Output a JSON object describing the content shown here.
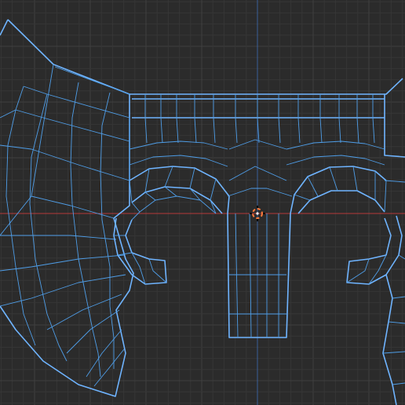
{
  "viewport": {
    "mode": "uv-editor-2d-view",
    "colors": {
      "background": "#2b2b2b",
      "grid_minor": "#363636",
      "grid_major": "#3f3f3f",
      "axis_x": "#b53a3a",
      "axis_y": "#3a5f99",
      "wire": "#4f9ee8",
      "wire_edge": "#6fb4ff",
      "cursor_ring": "#ff7a3a",
      "cursor_center": "#ffffff"
    }
  },
  "mesh": {
    "label": "uv-wireframe-mesh",
    "visible_islands": [
      "left-wing-fan",
      "top-band",
      "left-arch",
      "right-arch",
      "center-column",
      "right-lower-edge"
    ]
  },
  "cursor": {
    "icon": "3d-cursor-icon"
  }
}
